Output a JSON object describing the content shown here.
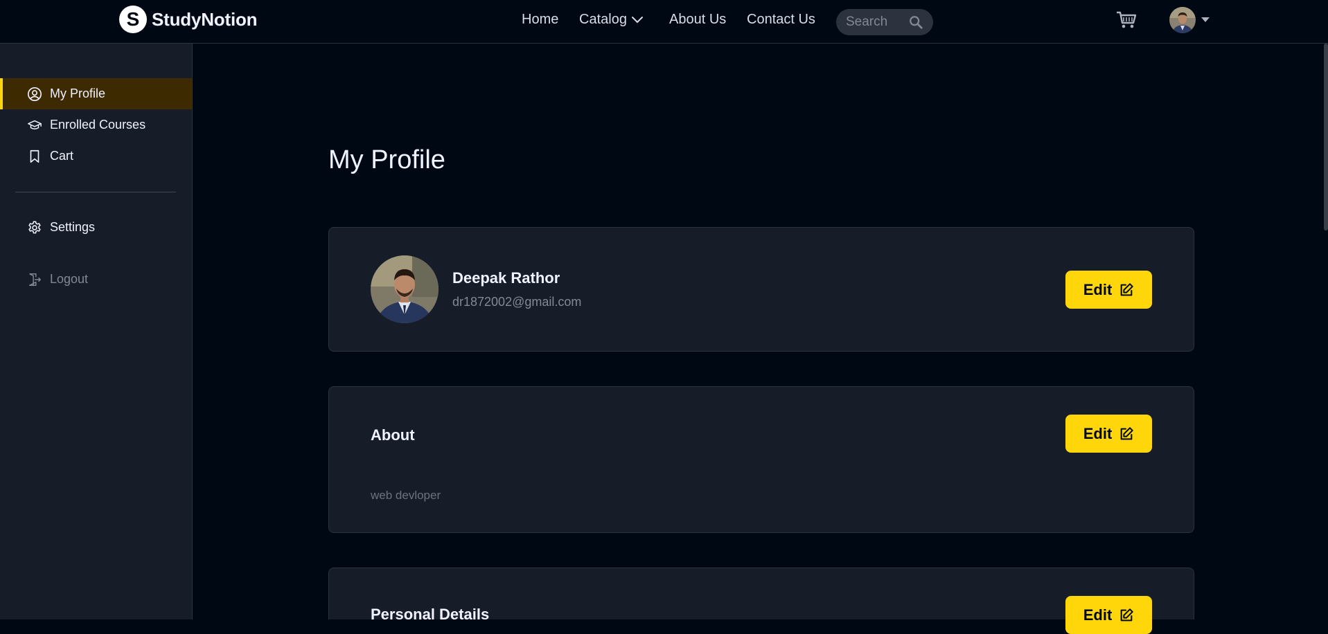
{
  "brand": {
    "logo_letter": "S",
    "name": "StudyNotion"
  },
  "nav": {
    "links": [
      "Home",
      "Catalog",
      "About Us",
      "Contact Us"
    ],
    "search_placeholder": "Search"
  },
  "sidebar": {
    "items": [
      {
        "label": "My Profile",
        "icon": "user-circle-icon",
        "active": true
      },
      {
        "label": "Enrolled Courses",
        "icon": "graduation-cap-icon"
      },
      {
        "label": "Cart",
        "icon": "bookmark-icon"
      }
    ],
    "settings_label": "Settings",
    "logout_label": "Logout"
  },
  "main": {
    "title": "My Profile",
    "profile": {
      "name": "Deepak Rathor",
      "email": "dr1872002@gmail.com",
      "edit_label": "Edit"
    },
    "about": {
      "title": "About",
      "text": "web devloper",
      "edit_label": "Edit"
    },
    "personal": {
      "title": "Personal Details",
      "edit_label": "Edit"
    }
  },
  "colors": {
    "accent": "#FFD60A",
    "background": "#000814",
    "card": "#161D29",
    "active_item_bg": "#3D2A01"
  }
}
